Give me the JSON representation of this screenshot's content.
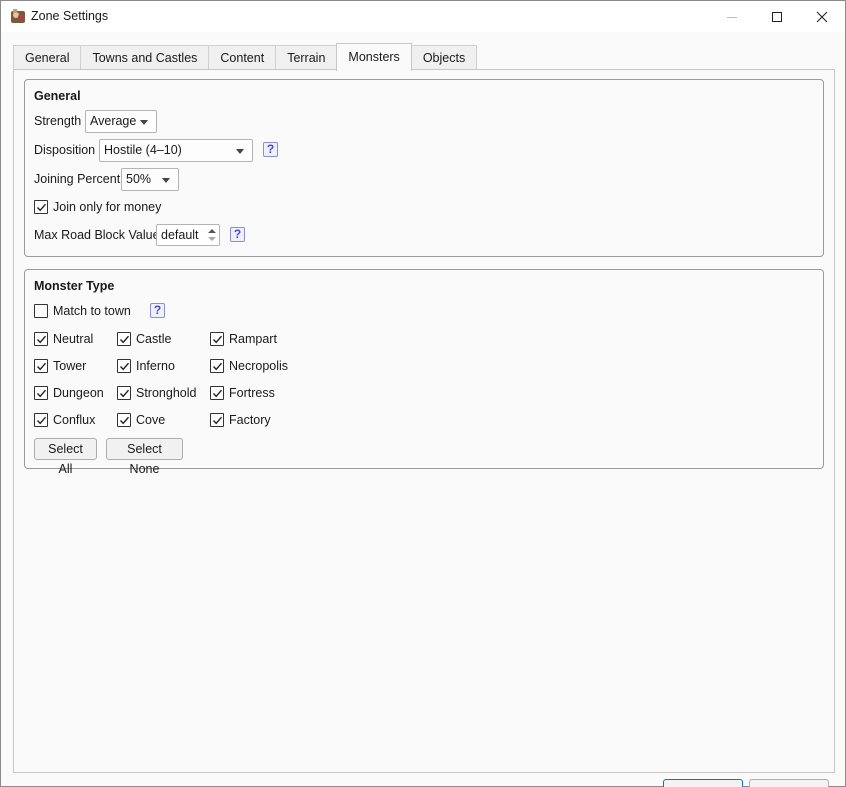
{
  "window": {
    "title": "Zone Settings"
  },
  "tabs": [
    {
      "label": "General",
      "active": false
    },
    {
      "label": "Towns and Castles",
      "active": false
    },
    {
      "label": "Content",
      "active": false
    },
    {
      "label": "Terrain",
      "active": false
    },
    {
      "label": "Monsters",
      "active": true
    },
    {
      "label": "Objects",
      "active": false
    }
  ],
  "general": {
    "title": "General",
    "strength_label": "Strength",
    "strength_value": "Average",
    "disposition_label": "Disposition",
    "disposition_value": "Hostile (4–10)",
    "joining_label": "Joining Percent",
    "joining_value": "50%",
    "join_money_label": "Join only for money",
    "join_money_checked": true,
    "max_road_label": "Max Road Block Value",
    "max_road_value": "default",
    "help_glyph": "?"
  },
  "monster_type": {
    "title": "Monster Type",
    "match_town_label": "Match to town",
    "match_town_checked": false,
    "factions": [
      {
        "label": "Neutral",
        "checked": true
      },
      {
        "label": "Castle",
        "checked": true
      },
      {
        "label": "Rampart",
        "checked": true
      },
      {
        "label": "Tower",
        "checked": true
      },
      {
        "label": "Inferno",
        "checked": true
      },
      {
        "label": "Necropolis",
        "checked": true
      },
      {
        "label": "Dungeon",
        "checked": true
      },
      {
        "label": "Stronghold",
        "checked": true
      },
      {
        "label": "Fortress",
        "checked": true
      },
      {
        "label": "Conflux",
        "checked": true
      },
      {
        "label": "Cove",
        "checked": true
      },
      {
        "label": "Factory",
        "checked": true
      }
    ],
    "select_all_label": "Select All",
    "select_none_label": "Select None"
  },
  "colors": {
    "focus_border": "#0078d7",
    "help_accent": "#4a4acd"
  }
}
